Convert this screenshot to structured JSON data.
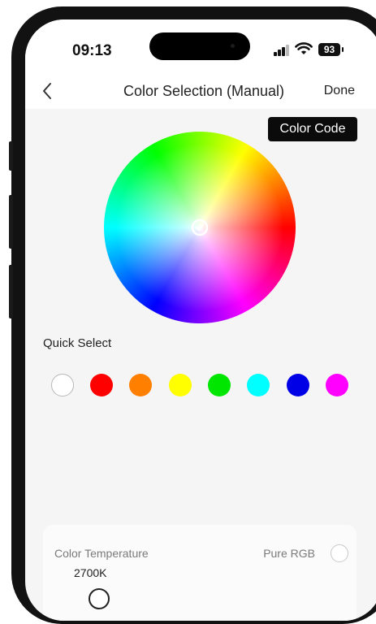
{
  "status_bar": {
    "time": "09:13",
    "battery": "93"
  },
  "nav": {
    "title": "Color Selection (Manual)",
    "done_label": "Done"
  },
  "color_code_label": "Color Code",
  "quick_select": {
    "label": "Quick Select",
    "colors": [
      "#ffffff",
      "#ff0000",
      "#ff8000",
      "#ffff00",
      "#00e600",
      "#00ffff",
      "#0000e6",
      "#ff00ff"
    ]
  },
  "temperature": {
    "label": "Color Temperature",
    "value": "2700K",
    "pure_rgb_label": "Pure RGB"
  },
  "colors": {
    "frame": "#121212",
    "screen_bg": "#f5f5f6",
    "button_dark": "#0b0b0b"
  }
}
